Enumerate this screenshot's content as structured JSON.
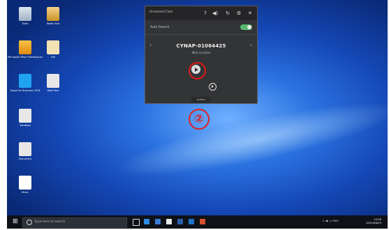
{
  "desktop": {
    "icons": [
      {
        "label": "Trash",
        "icon": "recycle-bin-icon"
      },
      {
        "label": "Tablet User",
        "icon": "user-folder-icon"
      },
      {
        "label": "Microsoft Office Professional",
        "icon": "office-icon"
      },
      {
        "label": "File",
        "icon": "folder-icon"
      },
      {
        "label": "Skype for Business 2016",
        "icon": "skype-icon"
      },
      {
        "label": "Word Doc",
        "icon": "document-icon"
      },
      {
        "label": "Windows",
        "icon": "windows-file-icon"
      },
      {
        "label": "Document",
        "icon": "document-icon"
      },
      {
        "label": "Music",
        "icon": "audio-icon"
      }
    ]
  },
  "player": {
    "app_title": "Unnamed Cam",
    "title_buttons": [
      "?",
      "◀)",
      "↻",
      "⚙",
      "✕"
    ],
    "auto_search_label": "Auto Search",
    "auto_search_on": true,
    "nav_prev": "‹",
    "nav_next": "›",
    "device_serial": "CYNAP-01064425",
    "status_text": "Wait Location",
    "footer_label": "Action"
  },
  "annotation": {
    "callout_number": "②",
    "highlight_color": "#e01818"
  },
  "taskbar": {
    "start_glyph": "⊞",
    "search_placeholder": "Type here to search",
    "pinned": [
      "task-view-icon",
      "edge-icon",
      "store-icon",
      "mail-icon",
      "word-icon",
      "outlook-icon",
      "powerpoint-icon"
    ],
    "tray": "∧  ◀)  ▭  ENG",
    "clock_time": "15:26",
    "clock_date": "2021/08/23"
  }
}
